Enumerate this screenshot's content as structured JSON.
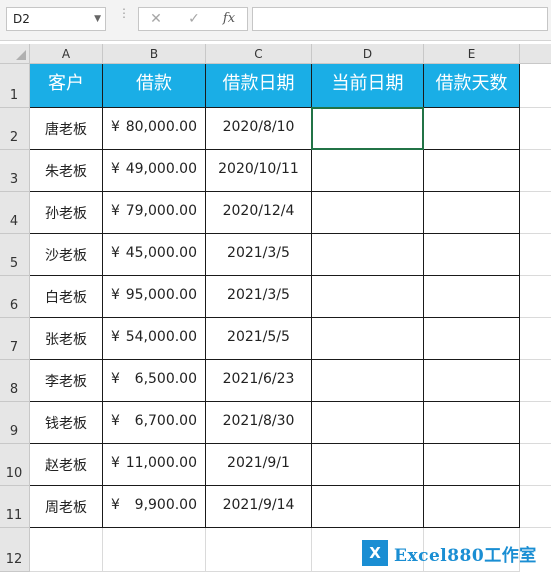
{
  "formula_bar": {
    "name_box": "D2",
    "cancel_icon": "✕",
    "enter_icon": "✓",
    "fx_label": "fx",
    "formula": ""
  },
  "columns": [
    "A",
    "B",
    "C",
    "D",
    "E"
  ],
  "rows": [
    "1",
    "2",
    "3",
    "4",
    "5",
    "6",
    "7",
    "8",
    "9",
    "10",
    "11",
    "12"
  ],
  "headers": [
    "客户",
    "借款",
    "借款日期",
    "当前日期",
    "借款天数"
  ],
  "currency_symbol": "¥",
  "records": [
    {
      "client": "唐老板",
      "amount": "80,000.00",
      "date": "2020/8/10",
      "current": "",
      "days": ""
    },
    {
      "client": "朱老板",
      "amount": "49,000.00",
      "date": "2020/10/11",
      "current": "",
      "days": ""
    },
    {
      "client": "孙老板",
      "amount": "79,000.00",
      "date": "2020/12/4",
      "current": "",
      "days": ""
    },
    {
      "client": "沙老板",
      "amount": "45,000.00",
      "date": "2021/3/5",
      "current": "",
      "days": ""
    },
    {
      "client": "白老板",
      "amount": "95,000.00",
      "date": "2021/3/5",
      "current": "",
      "days": ""
    },
    {
      "client": "张老板",
      "amount": "54,000.00",
      "date": "2021/5/5",
      "current": "",
      "days": ""
    },
    {
      "client": "李老板",
      "amount": "6,500.00",
      "date": "2021/6/23",
      "current": "",
      "days": ""
    },
    {
      "client": "钱老板",
      "amount": "6,700.00",
      "date": "2021/8/30",
      "current": "",
      "days": ""
    },
    {
      "client": "赵老板",
      "amount": "11,000.00",
      "date": "2021/9/1",
      "current": "",
      "days": ""
    },
    {
      "client": "周老板",
      "amount": "9,900.00",
      "date": "2021/9/14",
      "current": "",
      "days": ""
    }
  ],
  "watermark": {
    "logo_text": "X",
    "text": "Excel880工作室"
  },
  "colors": {
    "header_fill": "#1aaee6",
    "selection": "#217346",
    "watermark": "#1a8ed3"
  }
}
